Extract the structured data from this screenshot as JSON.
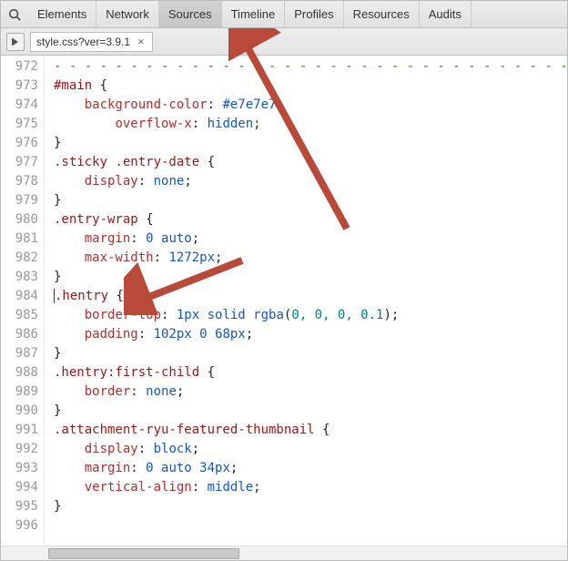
{
  "toolbar": {
    "tabs": [
      {
        "label": "Elements",
        "active": false
      },
      {
        "label": "Network",
        "active": false
      },
      {
        "label": "Sources",
        "active": true
      },
      {
        "label": "Timeline",
        "active": false
      },
      {
        "label": "Profiles",
        "active": false
      },
      {
        "label": "Resources",
        "active": false
      },
      {
        "label": "Audits",
        "active": false
      }
    ]
  },
  "file_tab": {
    "name": "style.css?ver=3.9.1",
    "close_glyph": "×"
  },
  "gutter": {
    "start": 972,
    "end": 996
  },
  "code_lines": [
    {
      "n": 972,
      "tokens": [
        {
          "t": "- - - - - - - - - - - - - - - - - - - - - - - - - - - - - - - - - - - - - - */",
          "c": "c-comment"
        }
      ]
    },
    {
      "n": 973,
      "tokens": [
        {
          "t": "#main",
          "c": "c-selector"
        },
        {
          "t": " {",
          "c": "c-brace"
        }
      ]
    },
    {
      "n": 974,
      "tokens": [
        {
          "t": "    ",
          "c": ""
        },
        {
          "t": "background-color",
          "c": "c-prop"
        },
        {
          "t": ": ",
          "c": "c-punct"
        },
        {
          "t": "#e7e7e7",
          "c": "c-hex"
        },
        {
          "t": ";",
          "c": "c-punct"
        }
      ]
    },
    {
      "n": 975,
      "tokens": [
        {
          "t": "        ",
          "c": ""
        },
        {
          "t": "overflow-x",
          "c": "c-prop"
        },
        {
          "t": ": ",
          "c": "c-punct"
        },
        {
          "t": "hidden",
          "c": "c-value"
        },
        {
          "t": ";",
          "c": "c-punct"
        }
      ]
    },
    {
      "n": 976,
      "tokens": [
        {
          "t": "}",
          "c": "c-brace"
        }
      ]
    },
    {
      "n": 977,
      "tokens": [
        {
          "t": ".sticky .entry-date",
          "c": "c-selector"
        },
        {
          "t": " {",
          "c": "c-brace"
        }
      ]
    },
    {
      "n": 978,
      "tokens": [
        {
          "t": "    ",
          "c": ""
        },
        {
          "t": "display",
          "c": "c-prop"
        },
        {
          "t": ": ",
          "c": "c-punct"
        },
        {
          "t": "none",
          "c": "c-value"
        },
        {
          "t": ";",
          "c": "c-punct"
        }
      ]
    },
    {
      "n": 979,
      "tokens": [
        {
          "t": "}",
          "c": "c-brace"
        }
      ]
    },
    {
      "n": 980,
      "tokens": [
        {
          "t": ".entry-wrap",
          "c": "c-selector"
        },
        {
          "t": " {",
          "c": "c-brace"
        }
      ]
    },
    {
      "n": 981,
      "tokens": [
        {
          "t": "    ",
          "c": ""
        },
        {
          "t": "margin",
          "c": "c-prop"
        },
        {
          "t": ": ",
          "c": "c-punct"
        },
        {
          "t": "0 auto",
          "c": "c-value"
        },
        {
          "t": ";",
          "c": "c-punct"
        }
      ]
    },
    {
      "n": 982,
      "tokens": [
        {
          "t": "    ",
          "c": ""
        },
        {
          "t": "max-width",
          "c": "c-prop"
        },
        {
          "t": ": ",
          "c": "c-punct"
        },
        {
          "t": "1272px",
          "c": "c-num"
        },
        {
          "t": ";",
          "c": "c-punct"
        }
      ]
    },
    {
      "n": 983,
      "tokens": [
        {
          "t": "}",
          "c": "c-brace"
        }
      ]
    },
    {
      "n": 984,
      "cursor": true,
      "tokens": [
        {
          "t": ".hentry",
          "c": "c-selector"
        },
        {
          "t": " {",
          "c": "c-brace"
        }
      ]
    },
    {
      "n": 985,
      "tokens": [
        {
          "t": "    ",
          "c": ""
        },
        {
          "t": "border-top",
          "c": "c-prop"
        },
        {
          "t": ": ",
          "c": "c-punct"
        },
        {
          "t": "1px solid ",
          "c": "c-value"
        },
        {
          "t": "rgba",
          "c": "c-func"
        },
        {
          "t": "(",
          "c": "c-punct"
        },
        {
          "t": "0, 0, 0, 0.1",
          "c": "c-rgba-args"
        },
        {
          "t": ")",
          "c": "c-punct"
        },
        {
          "t": ";",
          "c": "c-punct"
        }
      ]
    },
    {
      "n": 986,
      "tokens": [
        {
          "t": "    ",
          "c": ""
        },
        {
          "t": "padding",
          "c": "c-prop"
        },
        {
          "t": ": ",
          "c": "c-punct"
        },
        {
          "t": "102px 0 68px",
          "c": "c-num"
        },
        {
          "t": ";",
          "c": "c-punct"
        }
      ]
    },
    {
      "n": 987,
      "tokens": [
        {
          "t": "}",
          "c": "c-brace"
        }
      ]
    },
    {
      "n": 988,
      "tokens": [
        {
          "t": ".hentry:first-child",
          "c": "c-selector"
        },
        {
          "t": " {",
          "c": "c-brace"
        }
      ]
    },
    {
      "n": 989,
      "tokens": [
        {
          "t": "    ",
          "c": ""
        },
        {
          "t": "border",
          "c": "c-prop"
        },
        {
          "t": ": ",
          "c": "c-punct"
        },
        {
          "t": "none",
          "c": "c-value"
        },
        {
          "t": ";",
          "c": "c-punct"
        }
      ]
    },
    {
      "n": 990,
      "tokens": [
        {
          "t": "}",
          "c": "c-brace"
        }
      ]
    },
    {
      "n": 991,
      "tokens": [
        {
          "t": ".attachment-ryu-featured-thumbnail",
          "c": "c-selector"
        },
        {
          "t": " {",
          "c": "c-brace"
        }
      ]
    },
    {
      "n": 992,
      "tokens": [
        {
          "t": "    ",
          "c": ""
        },
        {
          "t": "display",
          "c": "c-prop"
        },
        {
          "t": ": ",
          "c": "c-punct"
        },
        {
          "t": "block",
          "c": "c-value"
        },
        {
          "t": ";",
          "c": "c-punct"
        }
      ]
    },
    {
      "n": 993,
      "tokens": [
        {
          "t": "    ",
          "c": ""
        },
        {
          "t": "margin",
          "c": "c-prop"
        },
        {
          "t": ": ",
          "c": "c-punct"
        },
        {
          "t": "0 auto 34px",
          "c": "c-value"
        },
        {
          "t": ";",
          "c": "c-punct"
        }
      ]
    },
    {
      "n": 994,
      "tokens": [
        {
          "t": "    ",
          "c": ""
        },
        {
          "t": "vertical-align",
          "c": "c-prop"
        },
        {
          "t": ": ",
          "c": "c-punct"
        },
        {
          "t": "middle",
          "c": "c-value"
        },
        {
          "t": ";",
          "c": "c-punct"
        }
      ]
    },
    {
      "n": 995,
      "tokens": [
        {
          "t": "}",
          "c": "c-brace"
        }
      ]
    },
    {
      "n": 996,
      "tokens": [
        {
          "t": "",
          "c": ""
        }
      ]
    }
  ],
  "annotations": {
    "arrow_color": "#b94a3a"
  }
}
